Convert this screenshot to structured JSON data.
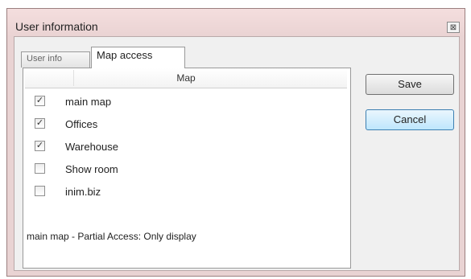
{
  "window": {
    "title": "User information",
    "close_glyph": "⊠"
  },
  "tabs": [
    {
      "label": "User info",
      "selected": false
    },
    {
      "label": "Map access",
      "selected": true
    }
  ],
  "map_access": {
    "column_header": "Map",
    "items": [
      {
        "label": "main map",
        "checked": true
      },
      {
        "label": "Offices",
        "checked": true
      },
      {
        "label": "Warehouse",
        "checked": true
      },
      {
        "label": "Show room",
        "checked": false
      },
      {
        "label": "inim.biz",
        "checked": false
      }
    ],
    "status_text": "main map - Partial Access: Only display"
  },
  "buttons": {
    "save": "Save",
    "cancel": "Cancel"
  }
}
